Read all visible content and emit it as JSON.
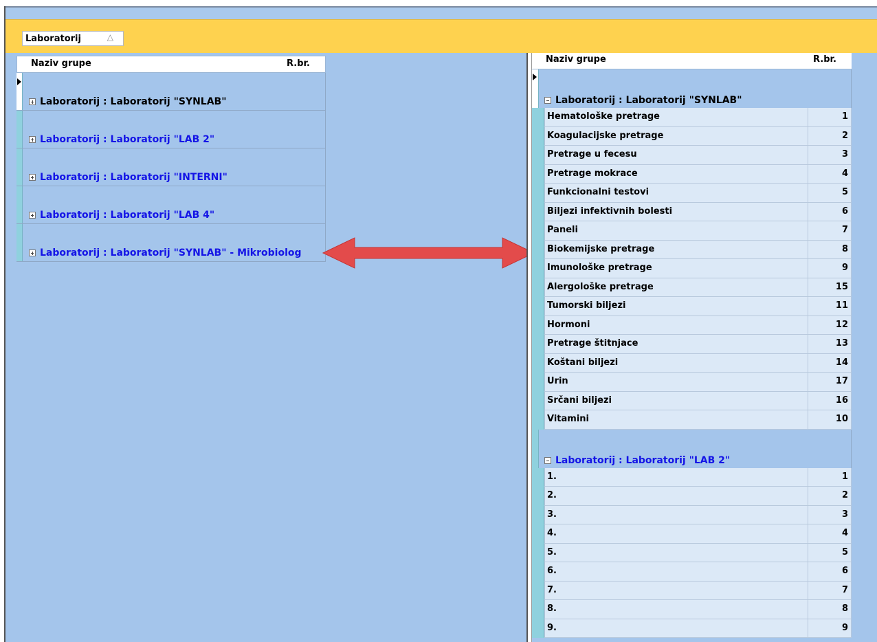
{
  "group_by": {
    "label": "Laboratorij",
    "sort_glyph": "△"
  },
  "left_grid": {
    "headers": {
      "name": "Naziv grupe",
      "rbr": "R.br."
    },
    "rows": [
      {
        "label": "Laboratorij : Laboratorij \"SYNLAB\"",
        "color": "#000000"
      },
      {
        "label": "Laboratorij : Laboratorij \"LAB 2\"",
        "color": "#1414e6"
      },
      {
        "label": "Laboratorij : Laboratorij \"INTERNI\"",
        "color": "#1414e6"
      },
      {
        "label": "Laboratorij : Laboratorij \"LAB 4\"",
        "color": "#1414e6"
      },
      {
        "label": "Laboratorij : Laboratorij \"SYNLAB\" - Mikrobiolog",
        "color": "#1414e6"
      }
    ]
  },
  "right_grid": {
    "headers": {
      "name": "Naziv grupe",
      "rbr": "R.br."
    },
    "group1": {
      "label": "Laboratorij : Laboratorij \"SYNLAB\"",
      "rows": [
        {
          "name": "Hematološke pretrage",
          "num": "1"
        },
        {
          "name": "Koagulacijske pretrage",
          "num": "2"
        },
        {
          "name": "Pretrage u fecesu",
          "num": "3"
        },
        {
          "name": "Pretrage mokrace",
          "num": "4"
        },
        {
          "name": "Funkcionalni testovi",
          "num": "5"
        },
        {
          "name": "Biljezi infektivnih bolesti",
          "num": "6"
        },
        {
          "name": "Paneli",
          "num": "7"
        },
        {
          "name": "Biokemijske pretrage",
          "num": "8"
        },
        {
          "name": "Imunološke pretrage",
          "num": "9"
        },
        {
          "name": "Alergološke pretrage",
          "num": "15"
        },
        {
          "name": "Tumorski biljezi",
          "num": "11"
        },
        {
          "name": "Hormoni",
          "num": "12"
        },
        {
          "name": "Pretrage štitnjace",
          "num": "13"
        },
        {
          "name": "Koštani biljezi",
          "num": "14"
        },
        {
          "name": "Urin",
          "num": "17"
        },
        {
          "name": "Srčani biljezi",
          "num": "16"
        },
        {
          "name": "Vitamini",
          "num": "10"
        }
      ]
    },
    "group2": {
      "label": "Laboratorij : Laboratorij \"LAB 2\"",
      "rows": [
        {
          "name": "1.",
          "num": "1"
        },
        {
          "name": "2.",
          "num": "2"
        },
        {
          "name": "3.",
          "num": "3"
        },
        {
          "name": "4.",
          "num": "4"
        },
        {
          "name": "5.",
          "num": "5"
        },
        {
          "name": "6.",
          "num": "6"
        },
        {
          "name": "7.",
          "num": "7"
        },
        {
          "name": "8.",
          "num": "8"
        },
        {
          "name": "9.",
          "num": "9"
        }
      ]
    }
  },
  "colors": {
    "arrow": "#e34b4b",
    "group_bar": "#fed24f",
    "background": "#a4c5eb"
  }
}
